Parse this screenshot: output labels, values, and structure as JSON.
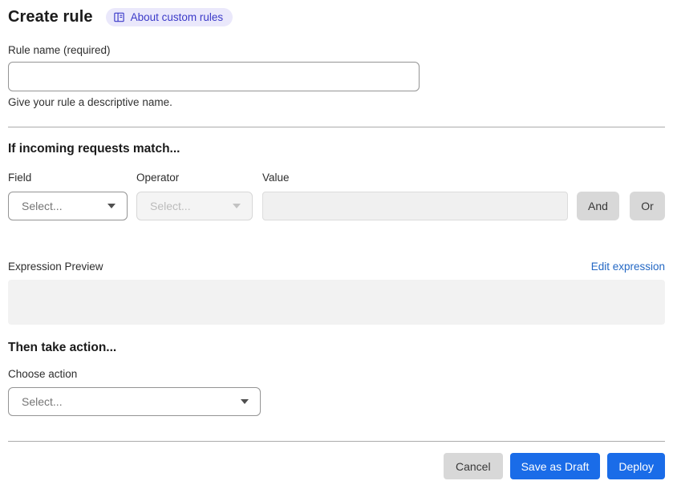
{
  "header": {
    "title": "Create rule",
    "about_badge_label": "About custom rules"
  },
  "rule_name": {
    "label": "Rule name (required)",
    "value": "",
    "helper": "Give your rule a descriptive name."
  },
  "match_section": {
    "heading": "If incoming requests match...",
    "field": {
      "label": "Field",
      "selected": "Select..."
    },
    "operator": {
      "label": "Operator",
      "selected": "Select..."
    },
    "value": {
      "label": "Value",
      "value": ""
    },
    "and_label": "And",
    "or_label": "Or"
  },
  "expression": {
    "label": "Expression Preview",
    "edit_link": "Edit expression",
    "content": ""
  },
  "action_section": {
    "heading": "Then take action...",
    "choose_label": "Choose action",
    "choose_selected": "Select..."
  },
  "footer": {
    "cancel": "Cancel",
    "save_draft": "Save as Draft",
    "deploy": "Deploy"
  },
  "colors": {
    "primary_blue": "#1a6ce8",
    "link_blue": "#2468c4",
    "badge_bg": "#eae8fb",
    "badge_text": "#3c3bc9",
    "disabled_bg": "#f4f4f4",
    "preview_bg": "#f2f2f2",
    "gray_button_bg": "#d8d8d8"
  }
}
